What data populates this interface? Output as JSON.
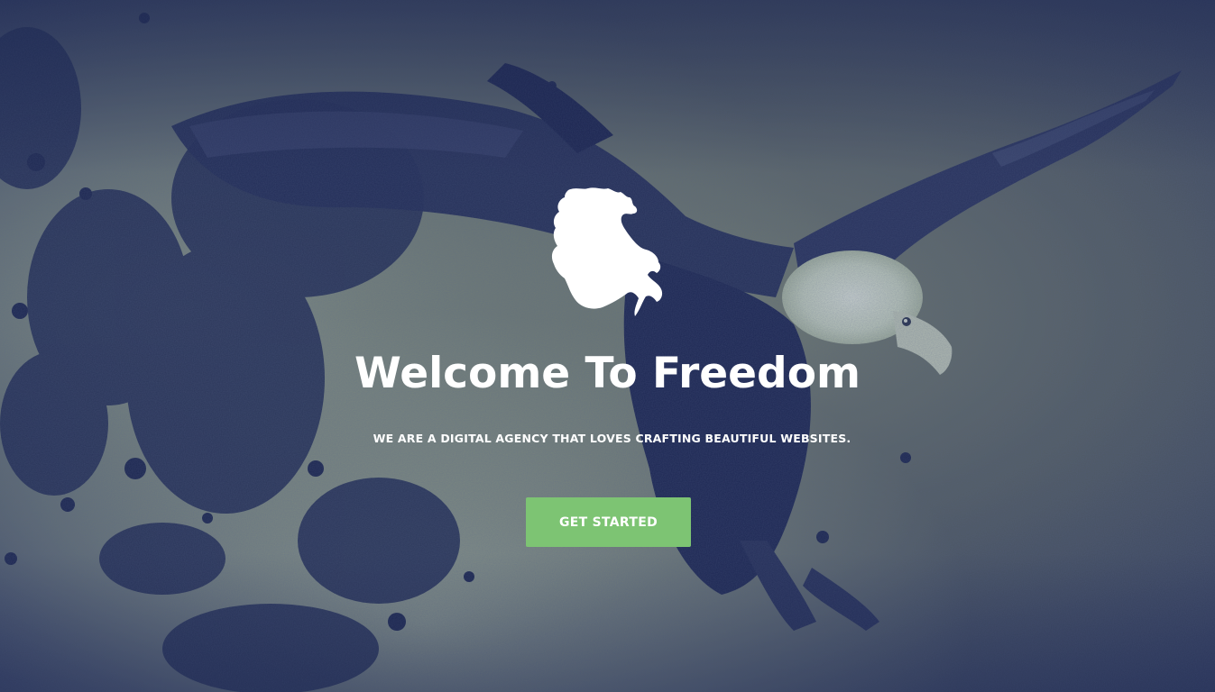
{
  "hero": {
    "logo_icon": "rearing-horse-icon",
    "background_image": "eagle-grunge-photo",
    "title": "Welcome To Freedom",
    "subtitle": "WE ARE A DIGITAL AGENCY THAT LOVES CRAFTING BEAUTIFUL WEBSITES.",
    "cta_label": "GET STARTED"
  },
  "colors": {
    "overlay_navy": "#1f2a52",
    "tint_green": "#a9b79a",
    "cta_green": "#7dc473",
    "text": "#ffffff"
  }
}
